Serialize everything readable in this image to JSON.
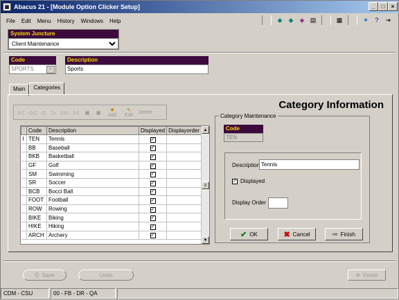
{
  "window": {
    "title": "Abacus 21 - [Module Option Clicker Setup]"
  },
  "menu": {
    "file": "File",
    "edit": "Edit",
    "menu": "Menu",
    "history": "History",
    "windows": "Windows",
    "help": "Help"
  },
  "juncture": {
    "label": "System Juncture",
    "value": "Client Maintenance"
  },
  "code": {
    "label": "Code",
    "value": "SPORTS"
  },
  "description": {
    "label": "Description",
    "value": "Sports"
  },
  "tabs": {
    "main": "Main",
    "categories": "Categories"
  },
  "panel": {
    "title": "Category Information"
  },
  "navbar": {
    "add": "Add",
    "edit": "Edit",
    "delete": "Delete"
  },
  "grid": {
    "headers": {
      "code": "Code",
      "description": "Description",
      "displayed": "Displayed",
      "displayorder": "Displayorder"
    },
    "rows": [
      {
        "code": "TEN",
        "description": "Tennis",
        "displayed": "✓"
      },
      {
        "code": "BB",
        "description": "Baseball",
        "displayed": "✓"
      },
      {
        "code": "BKB",
        "description": "Basketball",
        "displayed": "✓"
      },
      {
        "code": "GF",
        "description": "Golf",
        "displayed": "✓"
      },
      {
        "code": "SM",
        "description": "Swimming",
        "displayed": "✓"
      },
      {
        "code": "SR",
        "description": "Soccer",
        "displayed": "✓"
      },
      {
        "code": "BCB",
        "description": "Bocci Ball",
        "displayed": "✓"
      },
      {
        "code": "FOOT",
        "description": "Football",
        "displayed": "✓"
      },
      {
        "code": "ROW",
        "description": "Rowing",
        "displayed": "✓"
      },
      {
        "code": "BIKE",
        "description": "Biking",
        "displayed": "✓"
      },
      {
        "code": "HIKE",
        "description": "Hiking",
        "displayed": "✓"
      },
      {
        "code": "ARCH",
        "description": "Archery",
        "displayed": "✓"
      }
    ]
  },
  "catmaint": {
    "group_label": "Category Maintenance",
    "code_label": "Code",
    "code_value": "TEN",
    "description_label": "Description",
    "description_value": "Tennis",
    "displayed_label": "Displayed",
    "displayed_check": "✓",
    "display_order_label": "Display Order",
    "display_order_value": "",
    "ok": "OK",
    "cancel": "Cancel",
    "finish": "Finish"
  },
  "bottom": {
    "save": "Save",
    "undo": "Undo",
    "finish": "Finish"
  },
  "status": {
    "s1": "CDM - CSU",
    "s2": "00 - FB - DR - QA"
  }
}
